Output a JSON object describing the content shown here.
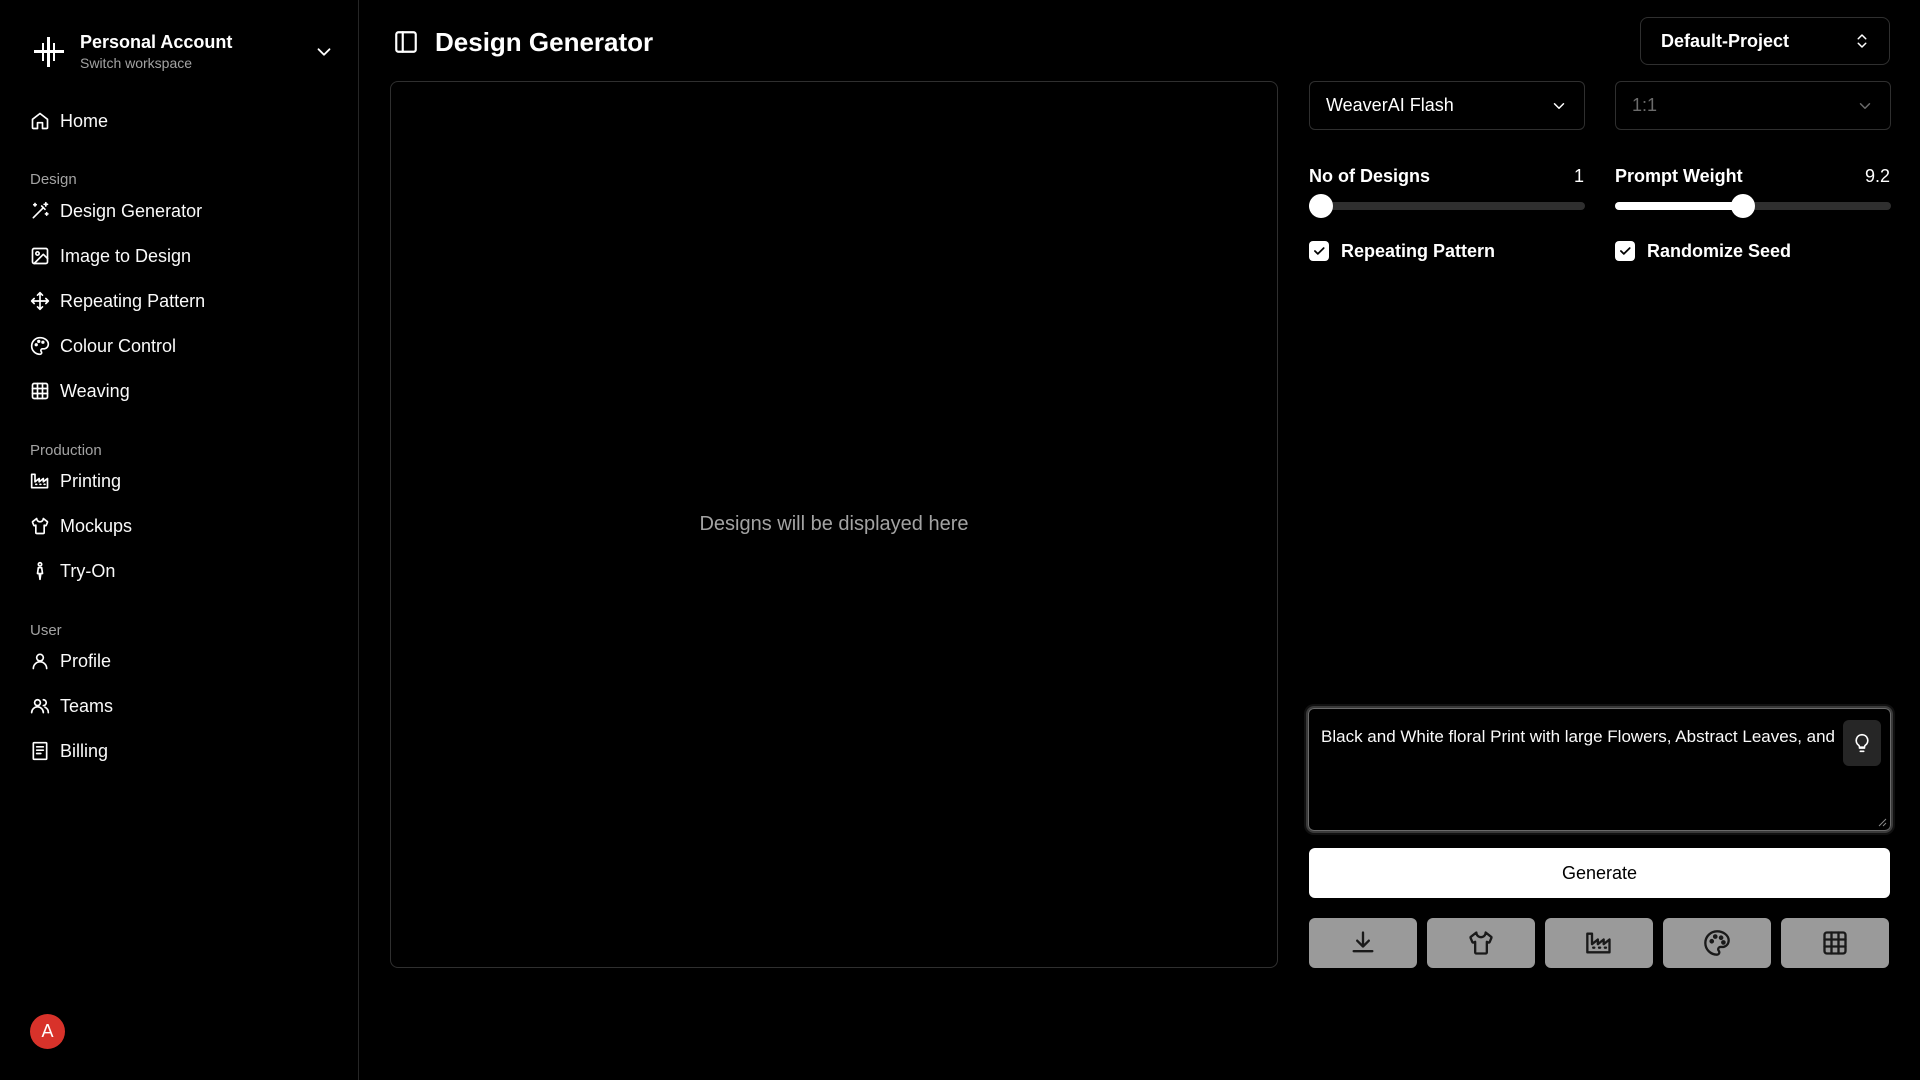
{
  "workspace": {
    "name": "Personal Account",
    "subtitle": "Switch workspace"
  },
  "nav": {
    "home": "Home",
    "design_section": "Design",
    "design_items": [
      "Design Generator",
      "Image to Design",
      "Repeating Pattern",
      "Colour Control",
      "Weaving"
    ],
    "production_section": "Production",
    "production_items": [
      "Printing",
      "Mockups",
      "Try-On"
    ],
    "user_section": "User",
    "user_items": [
      "Profile",
      "Teams",
      "Billing"
    ]
  },
  "user": {
    "avatar_initial": "A",
    "avatar_color": "#d8322a"
  },
  "header": {
    "title": "Design Generator",
    "project": "Default-Project"
  },
  "canvas": {
    "placeholder": "Designs will be displayed here"
  },
  "controls": {
    "model": "WeaverAI Flash",
    "aspect_ratio": "1:1",
    "designs_label": "No of Designs",
    "designs_value": "1",
    "designs_fraction": 0.0,
    "weight_label": "Prompt Weight",
    "weight_value": "9.2",
    "weight_fraction": 0.46,
    "repeating_pattern_label": "Repeating Pattern",
    "repeating_pattern_checked": true,
    "randomize_seed_label": "Randomize Seed",
    "randomize_seed_checked": true
  },
  "prompt": {
    "value": "Black and White floral Print with large Flowers, Abstract Leaves, and"
  },
  "generate_label": "Generate",
  "actions": [
    "download-icon",
    "shirt-icon",
    "factory-icon",
    "palette-icon",
    "grid-icon"
  ],
  "colors": {
    "background": "#000000",
    "accent": "#ffffff",
    "muted_text": "#a3a3a3",
    "action_button": "#9a9a9a"
  }
}
